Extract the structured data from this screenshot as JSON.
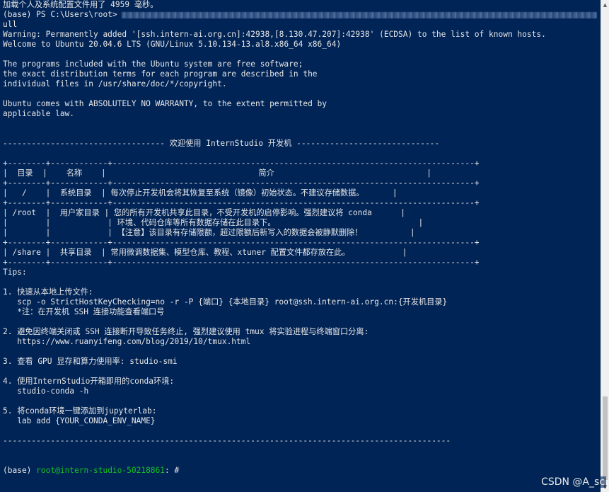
{
  "terminal": {
    "line_load": "加载个人及系统配置文件用了 4959 毫秒。",
    "prompt_local": "(base) PS C:\\Users\\root> ",
    "line_ull": "ull",
    "warning": "Warning: Permanently added '[ssh.intern-ai.org.cn]:42938,[8.130.47.207]:42938' (ECDSA) to the list of known hosts.",
    "welcome": "Welcome to Ubuntu 20.04.6 LTS (GNU/Linux 5.10.134-13.al8.x86_64 x86_64)",
    "free_1": "The programs included with the Ubuntu system are free software;",
    "free_2": "the exact distribution terms for each program are described in the",
    "free_3": "individual files in /usr/share/doc/*/copyright.",
    "warranty_1": "Ubuntu comes with ABSOLUTELY NO WARRANTY, to the extent permitted by",
    "warranty_2": "applicable law.",
    "banner": "---------------------------------- 欢迎使用 InternStudio 开发机 ------------------------------",
    "table": {
      "border": "+--------+------------+----------------------------------------------------------------------------+",
      "header": "|  目录  |    名称    |                                简介                                |",
      "rows": [
        [
          "|   /    |  系统目录  | 每次停止开发机会将其恢复至系统（镜像）初始状态。不建议存储数据。      |"
        ],
        [
          "| /root  |  用户家目录 | 您的所有开发机共享此目录，不受开发机的启停影响。强烈建议将 conda      |",
          "|        |            | 环境、代码仓库等所有数据存储在此目录下。                              |",
          "|        |            | 【注意】该目录有存储限额，超过限额后新写入的数据会被静默删除！          |"
        ],
        [
          "| /share |  共享目录  | 常用微调数据集、模型仓库、教程、xtuner 配置文件都存放在此。           |"
        ]
      ]
    },
    "tips_title": "Tips:",
    "tips": [
      {
        "title": "1. 快速从本地上传文件:",
        "lines": [
          "   scp -o StrictHostKeyChecking=no -r -P {端口} {本地目录} root@ssh.intern-ai.org.cn:{开发机目录}",
          "   *注：在开发机 SSH 连接功能查看端口号"
        ]
      },
      {
        "title": "2. 避免因终端关闭或 SSH 连接断开导致任务终止, 强烈建议使用 tmux 将实验进程与终端窗口分离:",
        "lines": [
          "   https://www.ruanyifeng.com/blog/2019/10/tmux.html"
        ]
      },
      {
        "title": "3. 查看 GPU 显存和算力使用率: studio-smi",
        "lines": []
      },
      {
        "title": "4. 使用InternStudio开箱即用的conda环境:",
        "lines": [
          "   studio-conda -h"
        ]
      },
      {
        "title": "5. 将conda环境一键添加到jupyterlab:",
        "lines": [
          "   lab add {YOUR_CONDA_ENV_NAME}"
        ]
      }
    ],
    "footer_rule": "----------------------------------------------------------------------------------------------",
    "prompt_env": "(base) ",
    "prompt_user": "root@intern-studio-50218861",
    "prompt_tail": ": #"
  },
  "watermark": "CSDN @A_sc",
  "colors": {
    "background": "#012456",
    "text": "#e6e6e6",
    "prompt_green": "#13c21f"
  }
}
